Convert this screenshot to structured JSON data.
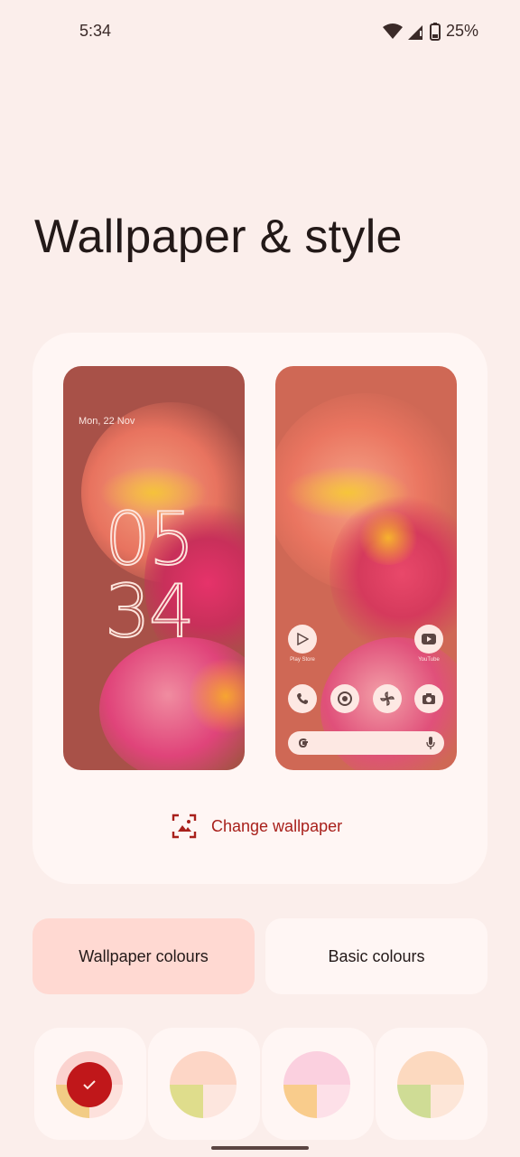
{
  "status_bar": {
    "time": "5:34",
    "battery_percent": "25%",
    "icons": [
      "wifi-icon",
      "signal-icon",
      "battery-icon"
    ]
  },
  "page": {
    "title": "Wallpaper & style"
  },
  "preview": {
    "lock_screen": {
      "date": "Mon, 22 Nov",
      "clock_hours": "05",
      "clock_minutes": "34"
    },
    "home_screen": {
      "apps_row1": [
        {
          "label": "Play Store",
          "icon": "play-store-icon"
        },
        {
          "label": "YouTube",
          "icon": "youtube-icon"
        }
      ],
      "dock": [
        {
          "icon": "phone-icon"
        },
        {
          "icon": "chrome-icon"
        },
        {
          "icon": "pinwheel-icon"
        },
        {
          "icon": "camera-icon"
        }
      ],
      "search_bar": {
        "left_icon": "google-g-icon",
        "right_icon": "mic-icon"
      }
    },
    "change_wallpaper_label": "Change wallpaper"
  },
  "colour_tabs": {
    "wallpaper_label": "Wallpaper colours",
    "basic_label": "Basic colours",
    "selected": "Wallpaper colours"
  },
  "swatches": [
    {
      "top": "#fbd3cf",
      "bottom_left": "#f2cc85",
      "bottom_right": "#fde1dc",
      "selected": true,
      "check_color": "#c0171a"
    },
    {
      "top": "#fdd6c6",
      "bottom_left": "#dfdd8c",
      "bottom_right": "#fde6de",
      "selected": false
    },
    {
      "top": "#fbd0df",
      "bottom_left": "#f9cc8c",
      "bottom_right": "#fde0e8",
      "selected": false
    },
    {
      "top": "#fcd9bf",
      "bottom_left": "#cfdc95",
      "bottom_right": "#fde6d8",
      "selected": false
    }
  ],
  "colors": {
    "background": "#fbeeeb",
    "card": "#fff6f4",
    "accent": "#a8201b",
    "selected_tab": "#ffd9d2"
  }
}
